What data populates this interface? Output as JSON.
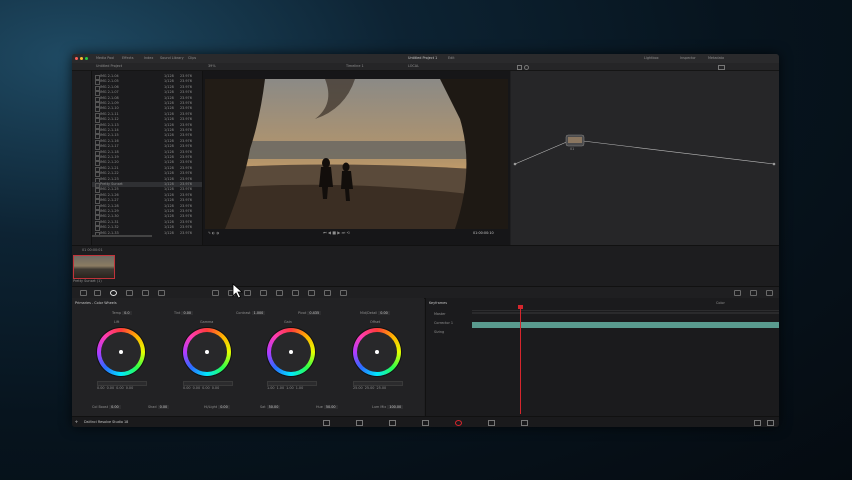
{
  "window": {
    "title": "Untitled Project 1",
    "title_suffix": "Edit",
    "traffic_lights": [
      "#ff5f57",
      "#febc2e",
      "#28c840"
    ]
  },
  "toolbar": {
    "left": [
      "Media Pool",
      "Effects",
      "Index",
      "Sound Library",
      "Clips"
    ],
    "right": [
      "Lightbox",
      "Inspector",
      "Metadata"
    ],
    "center_tabs": [
      "Timeline 1",
      "LOCAL"
    ]
  },
  "media_pool": {
    "header": "Untitled Project",
    "zoom": "39%",
    "rows": [
      {
        "name": "IMG 2-1-04",
        "c2": "1/128",
        "c3": "23.976"
      },
      {
        "name": "IMG 2-1-05",
        "c2": "1/128",
        "c3": "23.976"
      },
      {
        "name": "IMG 2-1-06",
        "c2": "1/128",
        "c3": "23.976"
      },
      {
        "name": "IMG 2-1-07",
        "c2": "1/128",
        "c3": "23.976"
      },
      {
        "name": "IMG 2-1-08",
        "c2": "1/128",
        "c3": "23.976"
      },
      {
        "name": "IMG 2-1-09",
        "c2": "1/128",
        "c3": "23.976"
      },
      {
        "name": "IMG 2-1-10",
        "c2": "1/128",
        "c3": "23.976"
      },
      {
        "name": "IMG 2-1-11",
        "c2": "1/128",
        "c3": "23.976"
      },
      {
        "name": "IMG 2-1-12",
        "c2": "1/128",
        "c3": "23.976"
      },
      {
        "name": "IMG 2-1-13",
        "c2": "1/128",
        "c3": "23.976"
      },
      {
        "name": "IMG 2-1-14",
        "c2": "1/128",
        "c3": "23.976"
      },
      {
        "name": "IMG 2-1-15",
        "c2": "1/128",
        "c3": "23.976"
      },
      {
        "name": "IMG 2-1-16",
        "c2": "1/128",
        "c3": "23.976"
      },
      {
        "name": "IMG 2-1-17",
        "c2": "1/128",
        "c3": "23.976"
      },
      {
        "name": "IMG 2-1-18",
        "c2": "1/128",
        "c3": "23.976"
      },
      {
        "name": "IMG 2-1-19",
        "c2": "1/128",
        "c3": "23.976"
      },
      {
        "name": "IMG 2-1-20",
        "c2": "1/128",
        "c3": "23.976"
      },
      {
        "name": "IMG 2-1-21",
        "c2": "1/128",
        "c3": "23.976"
      },
      {
        "name": "IMG 2-1-22",
        "c2": "1/128",
        "c3": "23.976"
      },
      {
        "name": "IMG 2-1-23",
        "c2": "1/128",
        "c3": "23.976"
      },
      {
        "name": "Pretty Sunset",
        "c2": "1/128",
        "c3": "23.976"
      },
      {
        "name": "IMG 2-1-25",
        "c2": "1/128",
        "c3": "23.976"
      },
      {
        "name": "IMG 2-1-26",
        "c2": "1/128",
        "c3": "23.976"
      },
      {
        "name": "IMG 2-1-27",
        "c2": "1/128",
        "c3": "23.976"
      },
      {
        "name": "IMG 2-1-28",
        "c2": "1/128",
        "c3": "23.976"
      },
      {
        "name": "IMG 2-1-29",
        "c2": "1/128",
        "c3": "23.976"
      },
      {
        "name": "IMG 2-1-30",
        "c2": "1/128",
        "c3": "23.976"
      },
      {
        "name": "IMG 2-1-31",
        "c2": "1/128",
        "c3": "23.976"
      },
      {
        "name": "IMG 2-1-32",
        "c2": "1/128",
        "c3": "23.976"
      },
      {
        "name": "IMG 2-1-33",
        "c2": "1/128",
        "c3": "23.976"
      }
    ]
  },
  "viewer": {
    "timecode": "01:00:00:10",
    "clip_label": "Timeline 1"
  },
  "node": {
    "label": "01"
  },
  "thumbstrip": {
    "label": "01 00:00:01",
    "clip_name": "Pretty Sunset (1)"
  },
  "color": {
    "panel_title": "Primaries - Color Wheels",
    "top_fields": [
      {
        "label": "Temp",
        "value": "0.0"
      },
      {
        "label": "Tint",
        "value": "0.00"
      },
      {
        "label": "Contrast",
        "value": "1.000"
      },
      {
        "label": "Pivot",
        "value": "0.435"
      },
      {
        "label": "Mid/Detail",
        "value": "0.00"
      }
    ],
    "wheels": [
      {
        "name": "Lift",
        "values": [
          "0.00",
          "0.00",
          "0.00",
          "0.00"
        ]
      },
      {
        "name": "Gamma",
        "values": [
          "0.00",
          "0.00",
          "0.00",
          "0.00"
        ]
      },
      {
        "name": "Gain",
        "values": [
          "1.00",
          "1.00",
          "1.00",
          "1.00"
        ]
      },
      {
        "name": "Offset",
        "values": [
          "25.00",
          "25.00",
          "25.00"
        ]
      }
    ],
    "bottom_fields": [
      {
        "label": "Col Boost",
        "value": "0.00"
      },
      {
        "label": "Shad",
        "value": "0.00"
      },
      {
        "label": "Hi/Light",
        "value": "0.00"
      },
      {
        "label": "Sat",
        "value": "50.00"
      },
      {
        "label": "Hue",
        "value": "50.00"
      },
      {
        "label": "Lum Mix",
        "value": "100.00"
      }
    ]
  },
  "keyframes": {
    "title": "Keyframes",
    "mode": "Color",
    "rows": [
      "Master",
      "Corrector 1",
      "Sizing"
    ]
  },
  "statusbar": {
    "app": "DaVinci Resolve Studio 18"
  }
}
